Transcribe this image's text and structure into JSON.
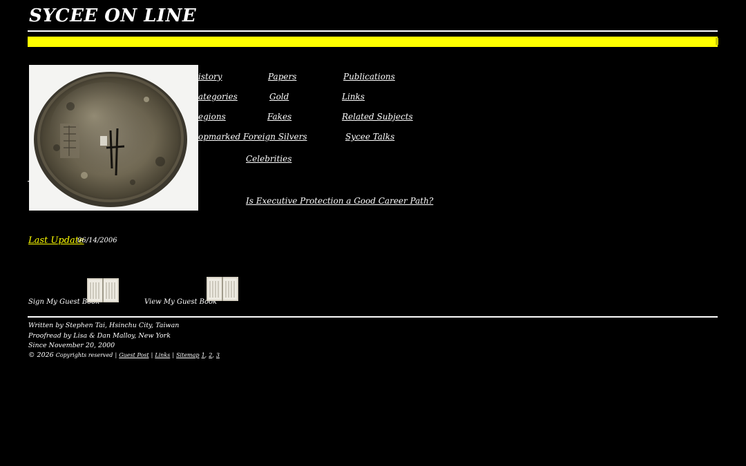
{
  "site": {
    "title": "SYCEE ON LINE"
  },
  "nav": {
    "history": "istory",
    "papers": "Papers",
    "publications": "Publications",
    "categories": "ategories",
    "gold": "Gold",
    "links": "Links",
    "regions": "egions",
    "fakes": "Fakes",
    "related_subjects": "Related Subjects",
    "chopmarked": "opmarked Foreign Silvers",
    "sycee_talks": "Sycee Talks",
    "celebrities": "Celebrities",
    "executive_link": "Is Executive Protection a Good Career Path?"
  },
  "update": {
    "label": "Last Update",
    "date": "06/14/2006"
  },
  "guestbook": {
    "sign_label": "Sign My Guest Book",
    "view_label": "View My Guest Book"
  },
  "footer": {
    "written_by": "Written by Stephen Tai, Hsinchu City, Taiwan",
    "proofread_by": "Proofread by Lisa & Dan Malloy, New York",
    "since": "Since November 20, 2000",
    "copyright_prefix": "© 2026",
    "copyright_text": "Copyrights reserved",
    "sep1": "|",
    "guest_post": "Guest Post",
    "sep2": "|",
    "links": "Links",
    "sep3": "|",
    "sitemap": "Sitemap",
    "sitemap_1": "1",
    "comma1": ",",
    "sitemap_2": "2",
    "comma2": ",",
    "sitemap_3": "3"
  },
  "colors": {
    "background": "#000000",
    "accent_bar": "#ffff00",
    "text": "#ffffff",
    "update_link": "#ffff00"
  }
}
